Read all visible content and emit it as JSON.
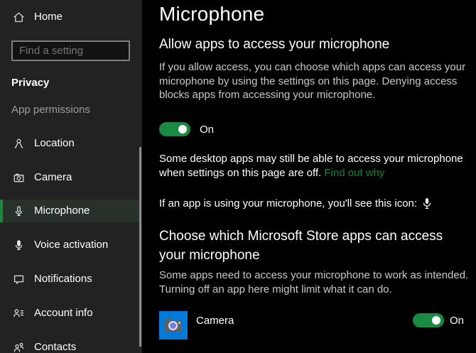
{
  "colors": {
    "sidebar_bg": "#222222",
    "main_bg": "#000000",
    "accent_green": "#1a8a42",
    "link_green": "#13833d",
    "selected_item_bg": "#29322a",
    "tile_blue": "#0079d8",
    "text_secondary": "#c9c9c9",
    "scrollbar": "#8c8c8c"
  },
  "sidebar": {
    "home_label": "Home",
    "search_placeholder": "Find a setting",
    "section_label": "Privacy",
    "group_label": "App permissions",
    "items": [
      {
        "label": "Location",
        "icon": "location-icon",
        "selected": false
      },
      {
        "label": "Camera",
        "icon": "camera-icon",
        "selected": false
      },
      {
        "label": "Microphone",
        "icon": "microphone-icon",
        "selected": true
      },
      {
        "label": "Voice activation",
        "icon": "voice-activation-icon",
        "selected": false
      },
      {
        "label": "Notifications",
        "icon": "notifications-icon",
        "selected": false
      },
      {
        "label": "Account info",
        "icon": "account-info-icon",
        "selected": false
      },
      {
        "label": "Contacts",
        "icon": "contacts-icon",
        "selected": false
      }
    ]
  },
  "main": {
    "title": "Microphone",
    "allow_section": {
      "heading": "Allow apps to access your microphone",
      "description": "If you allow access, you can choose which apps can access your microphone by using the settings on this page. Denying access blocks apps from accessing your microphone.",
      "toggle_state": "On"
    },
    "desktop_note": {
      "text": "Some desktop apps may still be able to access your microphone when settings on this page are off. ",
      "link_label": "Find out why"
    },
    "icon_note": "If an app is using your microphone, you'll see this icon:",
    "store_section": {
      "heading": "Choose which Microsoft Store apps can access your microphone",
      "description": "Some apps need to access your microphone to work as intended. Turning off an app here might limit what it can do.",
      "apps": [
        {
          "name": "Camera",
          "toggle_state": "On"
        }
      ]
    }
  }
}
